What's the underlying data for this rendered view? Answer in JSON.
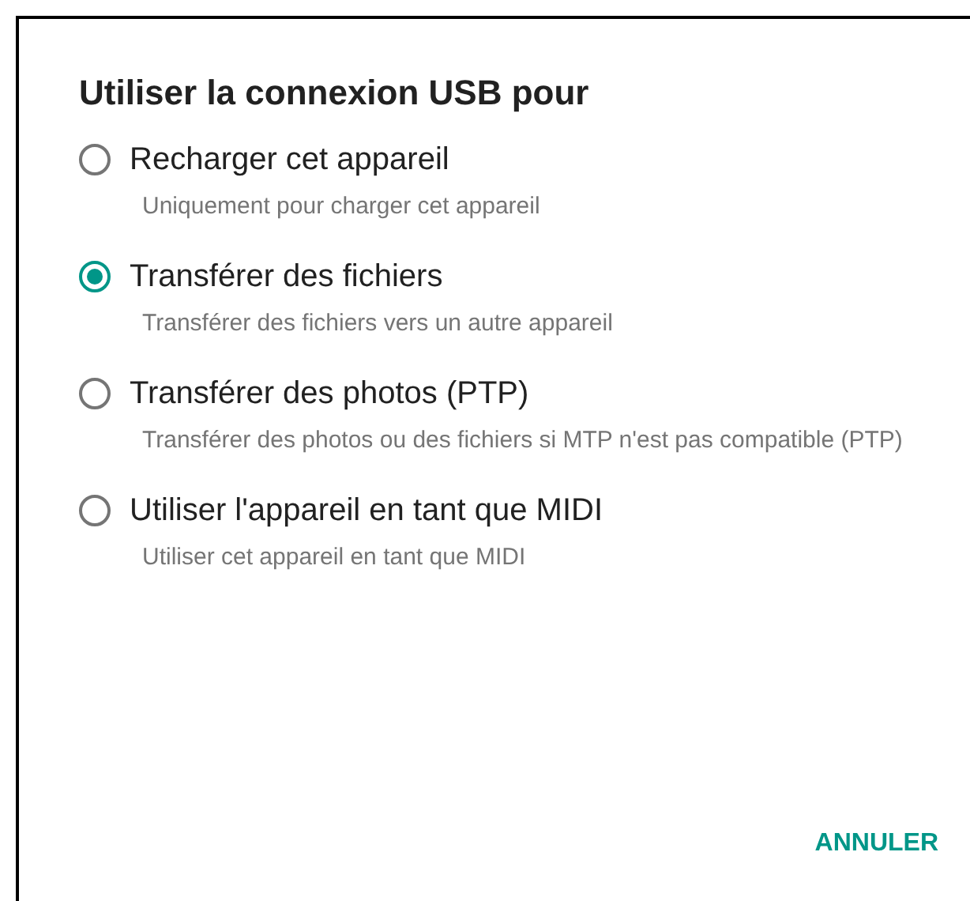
{
  "dialog": {
    "title": "Utiliser la connexion USB pour",
    "options": [
      {
        "label": "Recharger cet appareil",
        "description": "Uniquement pour charger cet appareil",
        "selected": false
      },
      {
        "label": "Transférer des fichiers",
        "description": "Transférer des fichiers vers un autre appareil",
        "selected": true
      },
      {
        "label": "Transférer des photos (PTP)",
        "description": "Transférer des photos ou des fichiers si MTP n'est pas compatible (PTP)",
        "selected": false
      },
      {
        "label": "Utiliser l'appareil en tant que MIDI",
        "description": "Utiliser cet appareil en tant que MIDI",
        "selected": false
      }
    ],
    "buttons": [
      "ANNULER"
    ]
  }
}
